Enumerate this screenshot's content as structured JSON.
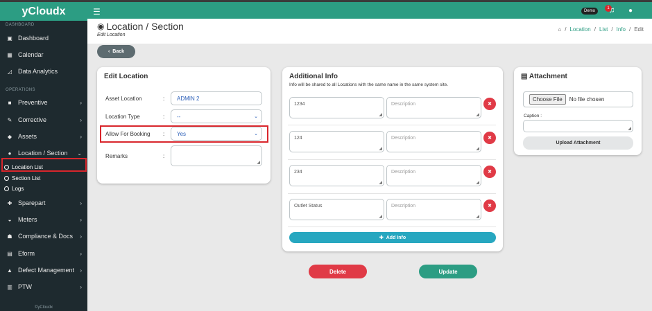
{
  "app": {
    "brand": "yCloudx",
    "copyright": "©yCloudx"
  },
  "sidebar": {
    "sections": {
      "dashboard": "DASHBOARD",
      "operations": "OPERATIONS"
    },
    "items": [
      {
        "label": "Dashboard",
        "icon": "dashboard-icon"
      },
      {
        "label": "Calendar",
        "icon": "calendar-icon"
      },
      {
        "label": "Data Analytics",
        "icon": "chart-icon"
      },
      {
        "label": "Preventive",
        "icon": "briefcase-icon"
      },
      {
        "label": "Corrective",
        "icon": "wrench-icon"
      },
      {
        "label": "Assets",
        "icon": "tag-icon"
      },
      {
        "label": "Location / Section",
        "icon": "globe-icon"
      },
      {
        "label": "Sparepart",
        "icon": "puzzle-icon"
      },
      {
        "label": "Meters",
        "icon": "gauge-icon"
      },
      {
        "label": "Compliance & Docs",
        "icon": "handshake-icon"
      },
      {
        "label": "Eform",
        "icon": "file-icon"
      },
      {
        "label": "Defect Management",
        "icon": "warning-icon"
      },
      {
        "label": "PTW",
        "icon": "database-icon"
      }
    ],
    "sub_items": [
      "Location List",
      "Section List",
      "Logs"
    ]
  },
  "topbar": {
    "user_badge": "Demo",
    "notification_count": "1"
  },
  "header": {
    "title": "Location / Section",
    "subtitle": "Edit Location",
    "breadcrumb": [
      "Location",
      "List",
      "Info",
      "Edit"
    ]
  },
  "back_label": "Back",
  "edit_location": {
    "title": "Edit Location",
    "asset_location_label": "Asset Location",
    "asset_location_value": "ADMIN 2",
    "location_type_label": "Location Type",
    "location_type_value": "--",
    "allow_booking_label": "Allow For Booking",
    "allow_booking_value": "Yes",
    "remarks_label": "Remarks",
    "colon": ":"
  },
  "additional_info": {
    "title": "Additional Info",
    "subtitle": "Info will be shared to all Locations with the same name in the same system site.",
    "description_placeholder": "Description",
    "rows": [
      "1234",
      "124",
      "234",
      "Outlet Status"
    ],
    "add_label": "Add Info"
  },
  "attachment": {
    "title": "Attachment",
    "choose_file_label": "Choose File",
    "no_file_text": "No file chosen",
    "caption_label": "Caption :",
    "upload_label": "Upload Attachment"
  },
  "actions": {
    "delete_label": "Delete",
    "update_label": "Update"
  },
  "colors": {
    "primary": "#2c9d83",
    "sidebar": "#1e2a2f",
    "danger": "#e03a46",
    "info": "#27a7c0",
    "highlight": "#d9262c"
  }
}
